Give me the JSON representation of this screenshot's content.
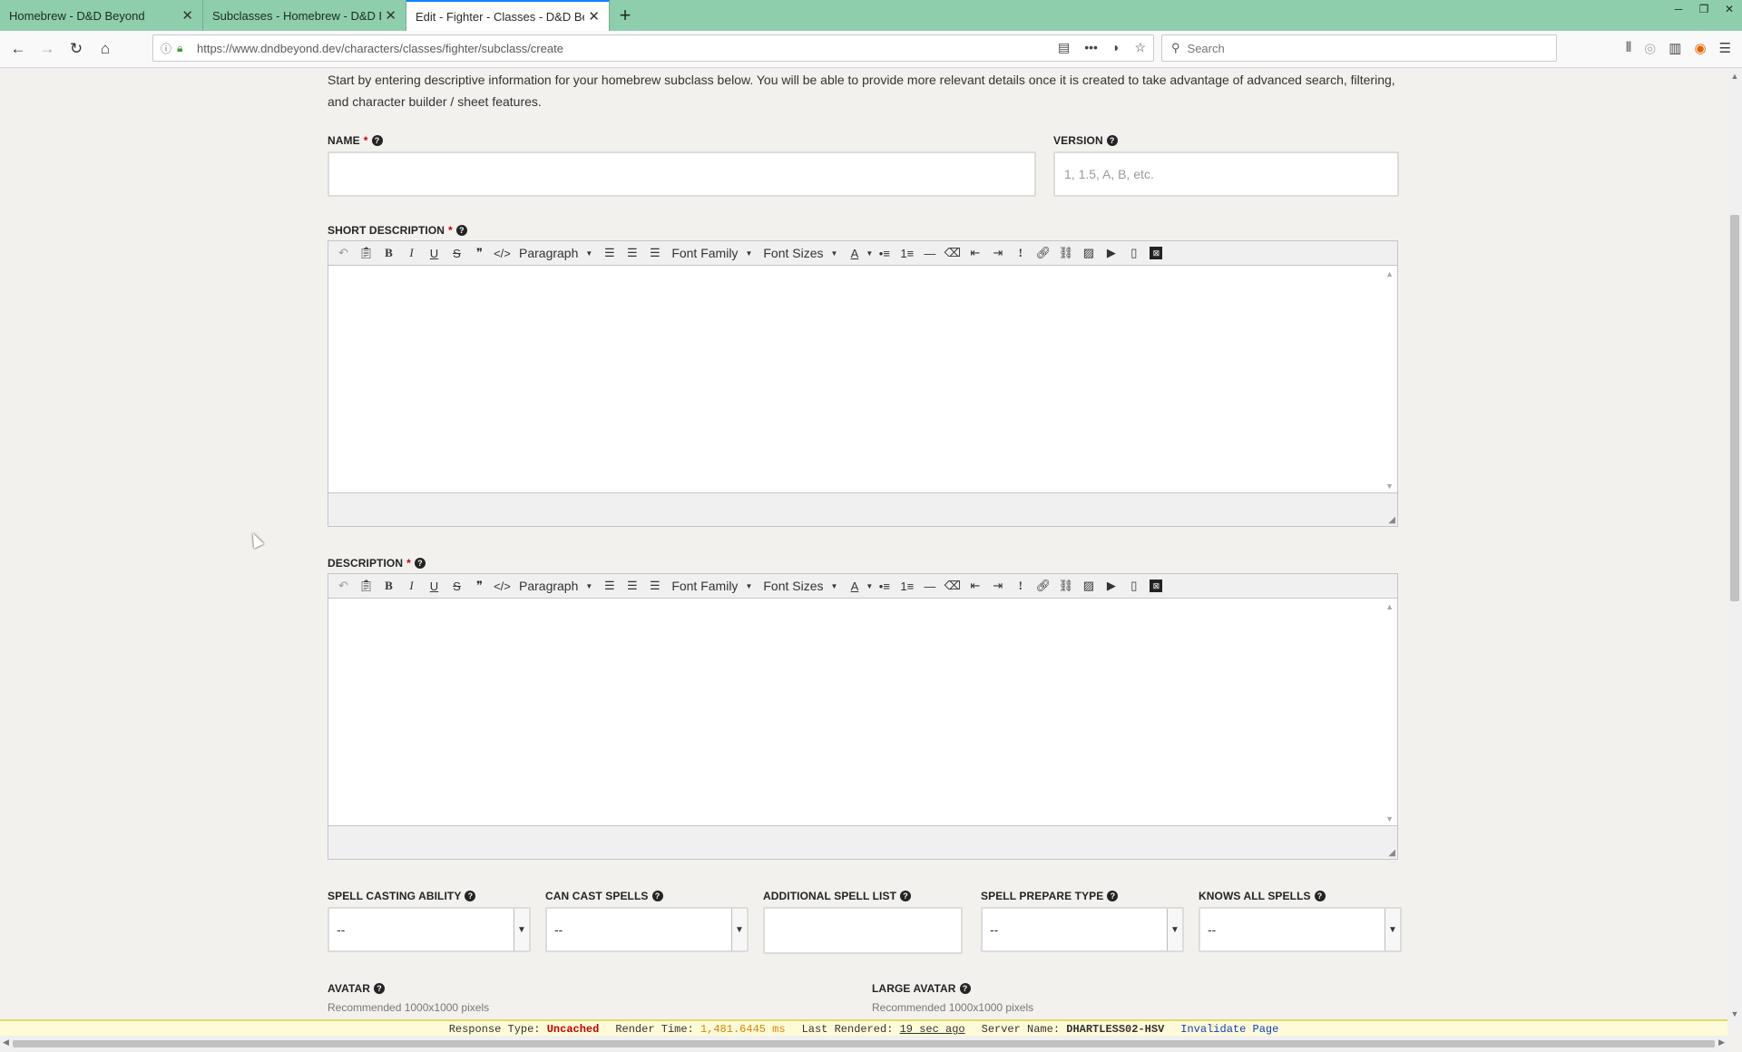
{
  "browser": {
    "tabs": [
      {
        "title": "Homebrew - D&D Beyond",
        "active": false
      },
      {
        "title": "Subclasses - Homebrew - D&D Beyond",
        "active": false
      },
      {
        "title": "Edit - Fighter - Classes - D&D Beyond",
        "active": true
      }
    ],
    "new_tab_label": "+",
    "url_host": "https://www.dndbeyond.dev",
    "url_path": "/characters/classes/fighter/subclass/create",
    "search_placeholder": "Search"
  },
  "form": {
    "intro": "Start by entering descriptive information for your homebrew subclass below. You will be able to provide more relevant details once it is created to take advantage of advanced search, filtering, and character builder / sheet features.",
    "name_label": "NAME",
    "name_value": "",
    "version_label": "VERSION",
    "version_placeholder": "1, 1.5, A, B, etc.",
    "short_desc_label": "SHORT DESCRIPTION",
    "desc_label": "DESCRIPTION",
    "required_mark": "*",
    "editor_toolbar": {
      "format_label": "Paragraph",
      "font_family_label": "Font Family",
      "font_sizes_label": "Font Sizes"
    },
    "spell_casting_label": "SPELL CASTING ABILITY",
    "spell_casting_value": "--",
    "can_cast_label": "CAN CAST SPELLS",
    "can_cast_value": "--",
    "additional_spell_label": "ADDITIONAL SPELL LIST",
    "additional_spell_value": "",
    "prepare_type_label": "SPELL PREPARE TYPE",
    "prepare_type_value": "--",
    "knows_all_label": "KNOWS ALL SPELLS",
    "knows_all_value": "--",
    "avatar_label": "AVATAR",
    "avatar_hint": "Recommended 1000x1000 pixels",
    "large_avatar_label": "LARGE AVATAR",
    "large_avatar_hint": "Recommended 1000x1000 pixels"
  },
  "debug_bar": {
    "response_label": "Response Type:",
    "response_value": "Uncached",
    "render_label": "Render Time:",
    "render_value": "1,481.6445 ms",
    "last_label": "Last Rendered:",
    "last_value": "19 sec ago",
    "server_label": "Server Name:",
    "server_value": "DHARTLESS02-HSV",
    "invalidate_label": "Invalidate Page"
  },
  "colors": {
    "tab_strip": "#8fceac",
    "required": "#cc0000",
    "debug_bg": "#fffbd9"
  }
}
